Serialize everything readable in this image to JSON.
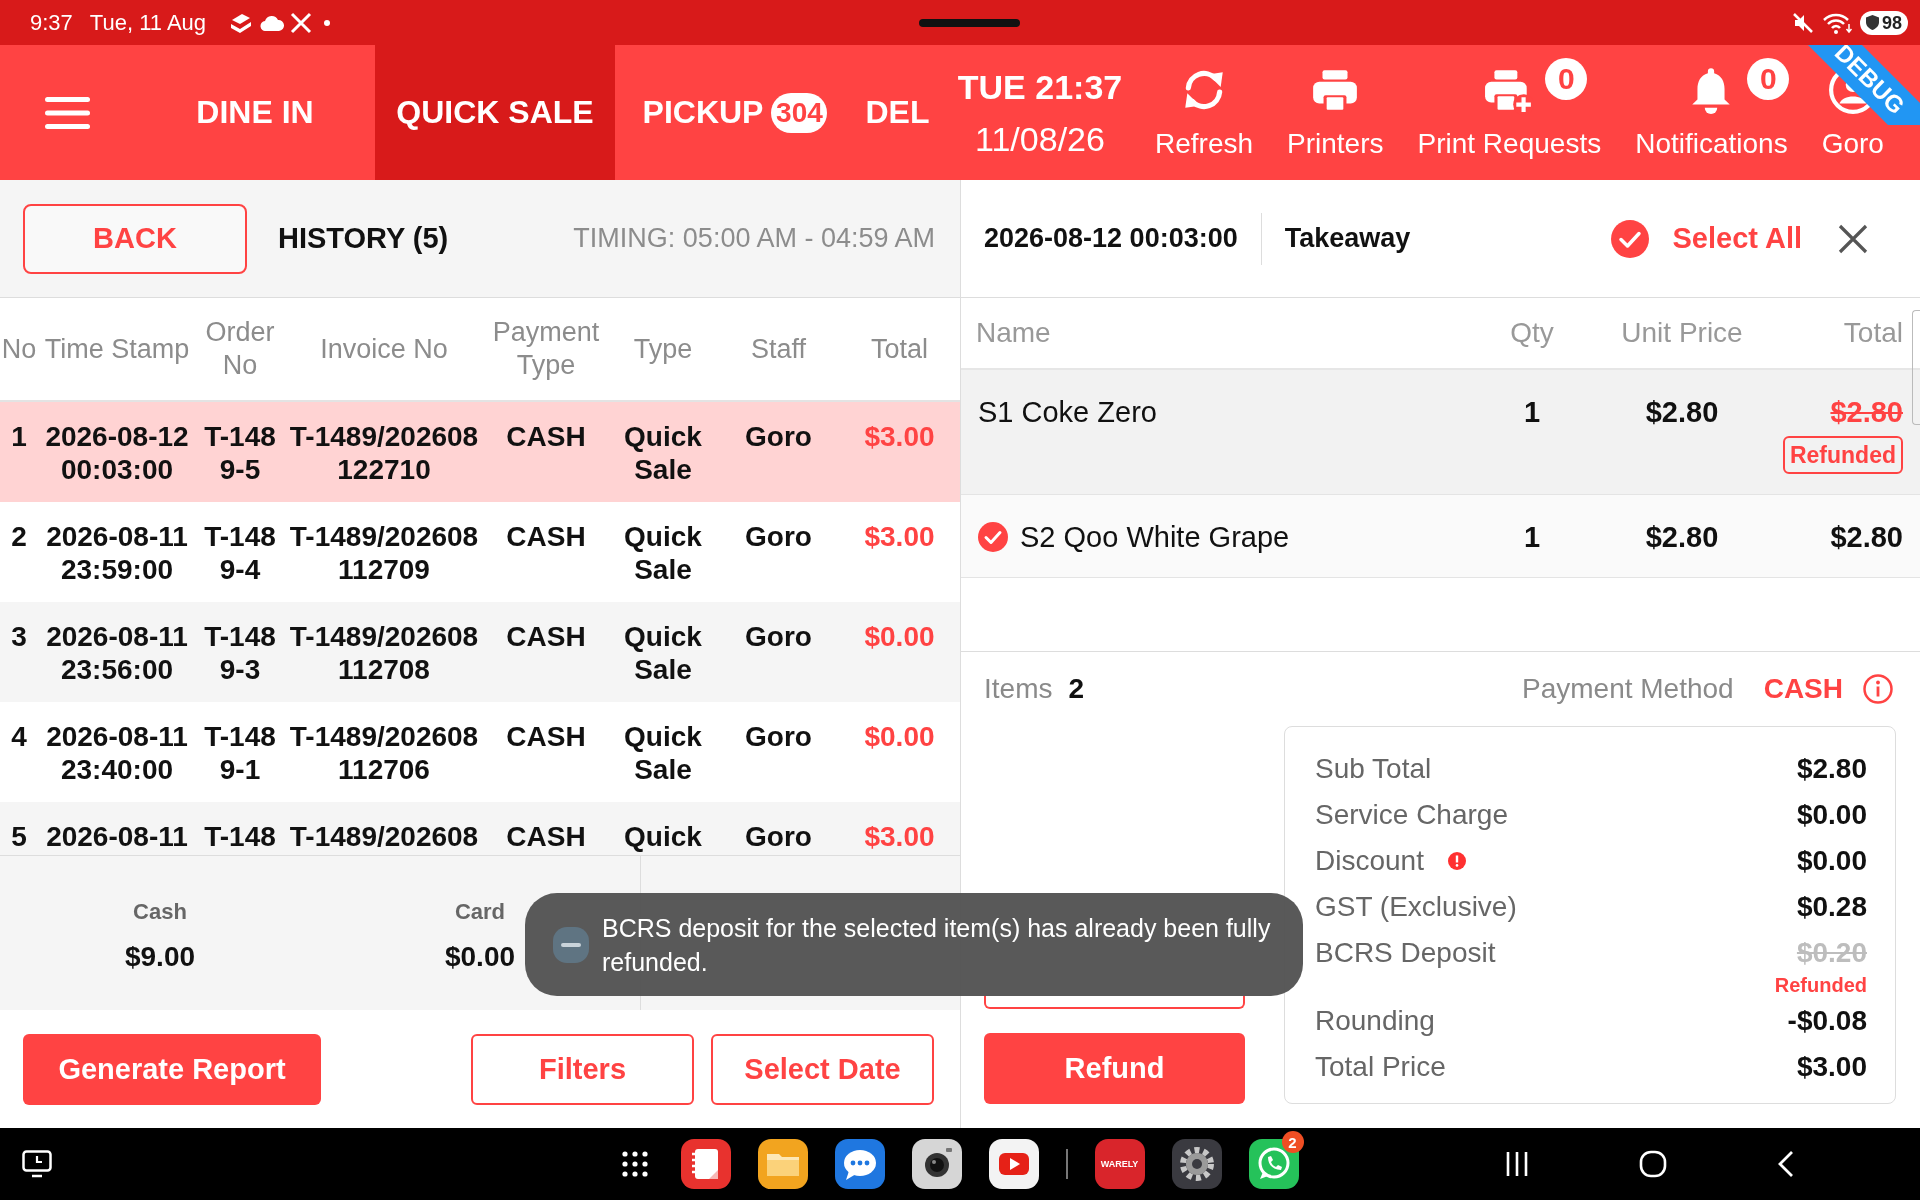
{
  "status_bar": {
    "time": "9:37",
    "date": "Tue, 11 Aug",
    "battery": "98"
  },
  "header": {
    "tabs": [
      {
        "label": "DINE IN",
        "selected": false
      },
      {
        "label": "QUICK SALE",
        "selected": true
      },
      {
        "label": "PICKUP",
        "selected": false,
        "badge": "304"
      },
      {
        "label": "DEL",
        "selected": false
      }
    ],
    "clock": {
      "day_time": "TUE 21:37",
      "date": "11/08/26"
    },
    "actions": [
      {
        "kind": "refresh",
        "label": "Refresh"
      },
      {
        "kind": "printer",
        "label": "Printers"
      },
      {
        "kind": "print_request",
        "label": "Print Requests",
        "badge": "0"
      },
      {
        "kind": "bell",
        "label": "Notifications",
        "badge": "0"
      },
      {
        "kind": "user",
        "label": "Goro"
      }
    ],
    "debug_banner": "DEBUG"
  },
  "history": {
    "back_button": "BACK",
    "title": "HISTORY (5)",
    "timing": "TIMING: 05:00 AM - 04:59 AM",
    "table": {
      "columns": [
        "No",
        "Time Stamp",
        "Order No",
        "Invoice No",
        "Payment Type",
        "Type",
        "Staff",
        "Total"
      ],
      "rows": [
        {
          "selected": true,
          "cells": [
            "1",
            "2026-08-12 00:03:00",
            "T-1489-5",
            "T-1489/202608122710",
            "CASH",
            "Quick Sale",
            "Goro",
            "$3.00"
          ]
        },
        {
          "selected": false,
          "cells": [
            "2",
            "2026-08-11 23:59:00",
            "T-1489-4",
            "T-1489/202608112709",
            "CASH",
            "Quick Sale",
            "Goro",
            "$3.00"
          ]
        },
        {
          "selected": false,
          "cells": [
            "3",
            "2026-08-11 23:56:00",
            "T-1489-3",
            "T-1489/202608112708",
            "CASH",
            "Quick Sale",
            "Goro",
            "$0.00"
          ]
        },
        {
          "selected": false,
          "cells": [
            "4",
            "2026-08-11 23:40:00",
            "T-1489-1",
            "T-1489/202608112706",
            "CASH",
            "Quick Sale",
            "Goro",
            "$0.00"
          ]
        },
        {
          "selected": false,
          "cells": [
            "5",
            "2026-08-11",
            "T-148",
            "T-1489/202608",
            "CASH",
            "Quick",
            "Goro",
            "$3.00"
          ]
        }
      ]
    },
    "totals": [
      {
        "label": "Cash",
        "value": "$9.00"
      },
      {
        "label": "Card",
        "value": "$0.00"
      }
    ],
    "buttons": [
      {
        "kind": "primary",
        "label": "Generate Report"
      },
      {
        "kind": "outline",
        "label": "Filters"
      },
      {
        "kind": "outline",
        "label": "Select Date"
      }
    ]
  },
  "order_detail": {
    "date_time": "2026-08-12 00:03:00",
    "order_type": "Takeaway",
    "select_all": {
      "label": "Select All",
      "checked": true
    },
    "columns": [
      "Name",
      "Qty",
      "Unit Price",
      "Total"
    ],
    "items": [
      {
        "name": "S1 Coke Zero",
        "qty": "1",
        "unit_price": "$2.80",
        "total": "$2.80",
        "selected": false,
        "refunded": true,
        "tag": "Refunded"
      },
      {
        "name": "S2 Qoo White Grape",
        "qty": "1",
        "unit_price": "$2.80",
        "total": "$2.80",
        "selected": true,
        "refunded": false
      }
    ],
    "items_label": "Items",
    "items_count": "2",
    "payment_method_label": "Payment Method",
    "payment_method": "CASH",
    "summary": [
      {
        "label": "Sub Total",
        "value": "$2.80",
        "alert": false,
        "refunded": false
      },
      {
        "label": "Service Charge",
        "value": "$0.00",
        "alert": false,
        "refunded": false
      },
      {
        "label": "Discount",
        "value": "$0.00",
        "alert": true,
        "refunded": false
      },
      {
        "label": "GST (Exclusive)",
        "value": "$0.28",
        "alert": false,
        "refunded": false
      },
      {
        "label": "BCRS Deposit",
        "value": "$0.20",
        "alert": false,
        "refunded": true,
        "note": "Refunded"
      },
      {
        "label": "Rounding",
        "value": "-$0.08",
        "alert": false,
        "refunded": false
      },
      {
        "label": "Total Price",
        "value": "$3.00",
        "alert": false,
        "refunded": false
      }
    ],
    "buttons": [
      {
        "kind": "outline"
      },
      {
        "kind": "primary",
        "label": "Refund"
      }
    ]
  },
  "toast": {
    "message": "BCRS deposit for the selected item(s) has already been fully refunded."
  },
  "nav_bar": {
    "apps": [
      {
        "kind": "notes"
      },
      {
        "kind": "folder"
      },
      {
        "kind": "chat"
      },
      {
        "kind": "camera"
      },
      {
        "kind": "video"
      },
      {
        "kind": "brand",
        "label": "WARELY"
      },
      {
        "kind": "settings"
      },
      {
        "kind": "chat_phone",
        "badge": "2"
      }
    ]
  }
}
